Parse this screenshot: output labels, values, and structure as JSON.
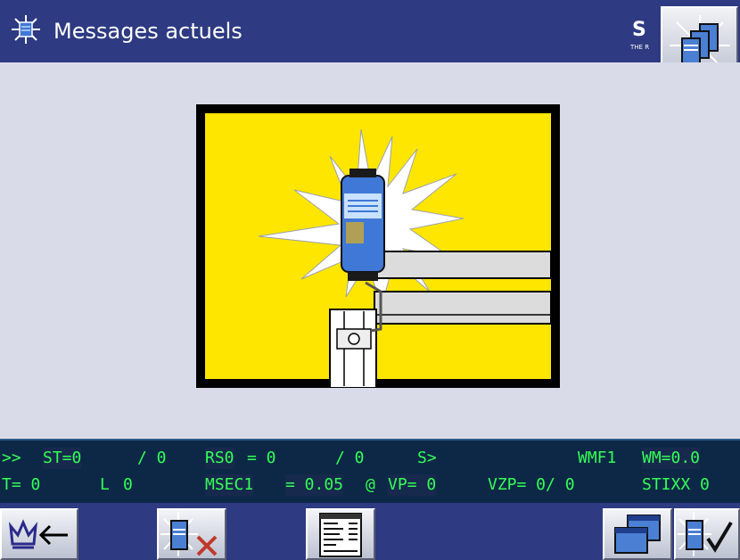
{
  "window": {
    "title": "Messages actuels",
    "title_icon": "burst-icon",
    "logo": {
      "letter": "S",
      "tagline": "THE R"
    },
    "corner_button_icon": "machine-stack-icon"
  },
  "illustration": {
    "description_icon": "sensor-alarm-illustration",
    "background_color": "#ffe600"
  },
  "status": {
    "line1": {
      "prefix": ">>",
      "st": "ST=0",
      "st_total": "/ 0",
      "rs": "RS0",
      "rs_value": "= 0",
      "rs_total": "/ 0",
      "s": "S>",
      "wmf": "WMF1",
      "wm": "WM=0.0"
    },
    "line2": {
      "t": "T= 0",
      "l": "L",
      "l_value": "0",
      "msec": "MSEC1",
      "msec_value": "= 0.05",
      "at": "@",
      "vp": "VP= 0",
      "vzp": "VZP= 0/ 0",
      "stixx": "STIXX 0"
    },
    "text_color": "#33ff55",
    "background_color": "#0d2847"
  },
  "toolbar": {
    "buttons": [
      {
        "name": "back-button",
        "icon": "crown-back-arrow-icon"
      },
      {
        "name": "cancel-machine-button",
        "icon": "machine-x-icon"
      },
      {
        "name": "document-button",
        "icon": "document-icon"
      },
      {
        "name": "windows-button",
        "icon": "windows-icon"
      },
      {
        "name": "confirm-machine-button",
        "icon": "machine-check-icon"
      }
    ]
  },
  "colors": {
    "titlebar": "#2e3a82",
    "main_background": "#d9dce8",
    "status_text": "#33ff55"
  }
}
